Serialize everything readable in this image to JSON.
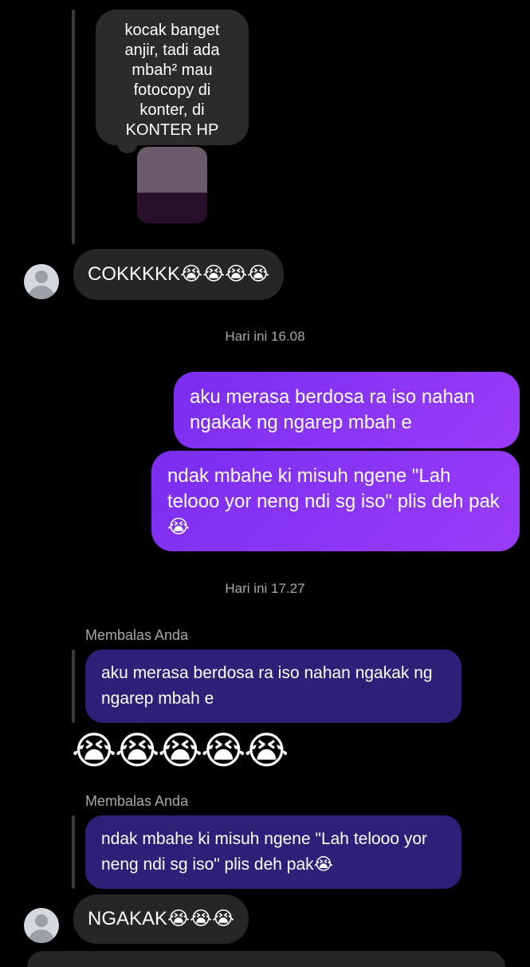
{
  "thread_top": {
    "quoted_story_text": "kocak banget\nanjir, tadi ada\nmbah² mau\nfotocopy di\nkonter, di\nKONTER HP"
  },
  "messages": {
    "incoming_1": "COKKKKK😭😭😭😭",
    "timestamp_1": "Hari ini 16.08",
    "outgoing_1": "aku merasa berdosa ra iso nahan ngakak ng ngarep mbah e",
    "outgoing_2": "ndak mbahe ki misuh ngene \"Lah telooo yor neng ndi sg iso\" plis deh pak😭",
    "timestamp_2": "Hari ini 17.27",
    "reply_caption_1": "Membalas Anda",
    "quoted_reply_1": "aku merasa berdosa ra iso nahan ngakak ng ngarep mbah e",
    "emoji_reaction": "😭😭😭😭😭",
    "reply_caption_2": "Membalas Anda",
    "quoted_reply_2": "ndak mbahe ki misuh ngene \"Lah telooo yor neng ndi sg iso\" plis deh pak😭",
    "incoming_2": "NGAKAK😭😭😭"
  },
  "icons": {
    "avatar": "default-user-avatar-icon"
  },
  "colors": {
    "background": "#000000",
    "incoming_bubble": "#262626",
    "outgoing_gradient_start": "#7b2df0",
    "outgoing_gradient_end": "#9a3cf7",
    "quoted_reply_bubble": "#2e1f78",
    "muted_text": "#a8a8a8"
  }
}
